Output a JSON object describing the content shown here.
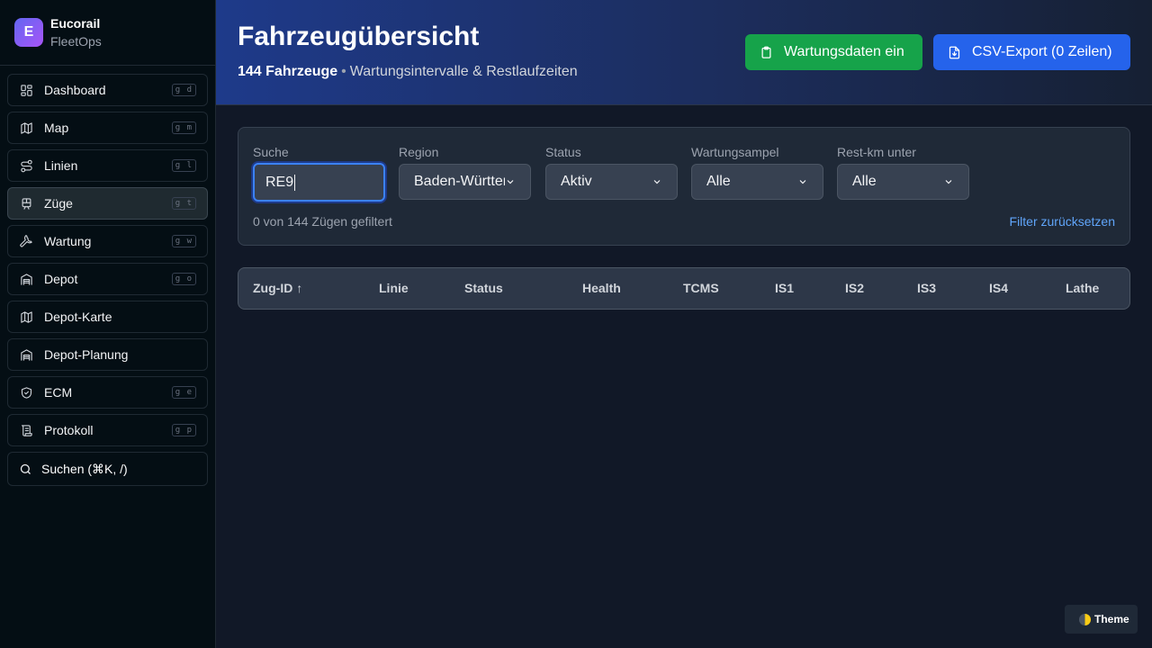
{
  "brand": {
    "logo_letter": "E",
    "name": "Eucorail",
    "sub": "FleetOps"
  },
  "sidebar": {
    "items": [
      {
        "label": "Dashboard",
        "shortcut": "g d",
        "icon": "dashboard-icon"
      },
      {
        "label": "Map",
        "shortcut": "g m",
        "icon": "map-icon"
      },
      {
        "label": "Linien",
        "shortcut": "g l",
        "icon": "route-icon"
      },
      {
        "label": "Züge",
        "shortcut": "g t",
        "icon": "train-icon",
        "active": true
      },
      {
        "label": "Wartung",
        "shortcut": "g w",
        "icon": "wrench-icon"
      },
      {
        "label": "Depot",
        "shortcut": "g o",
        "icon": "warehouse-icon"
      },
      {
        "label": "Depot-Karte",
        "shortcut": "",
        "icon": "map-icon"
      },
      {
        "label": "Depot-Planung",
        "shortcut": "",
        "icon": "warehouse-icon"
      },
      {
        "label": "ECM",
        "shortcut": "g e",
        "icon": "shield-icon"
      },
      {
        "label": "Protokoll",
        "shortcut": "g p",
        "icon": "scroll-icon"
      }
    ],
    "search_label": "Suchen (⌘K, /)"
  },
  "header": {
    "title": "Fahrzeugübersicht",
    "count": "144 Fahrzeuge",
    "separator": "•",
    "subtitle": "Wartungsintervalle & Restlaufzeiten",
    "btn_maintenance": "Wartungsdaten ein",
    "btn_export": "CSV-Export (0 Zeilen)"
  },
  "filters": {
    "search": {
      "label": "Suche",
      "value": "RE9"
    },
    "region": {
      "label": "Region",
      "value": "Baden-Württemberg"
    },
    "status": {
      "label": "Status",
      "value": "Aktiv"
    },
    "ampel": {
      "label": "Wartungsampel",
      "value": "Alle"
    },
    "restkm": {
      "label": "Rest-km unter",
      "value": "Alle"
    },
    "count_text": "0 von 144 Zügen gefiltert",
    "reset_label": "Filter zurücksetzen"
  },
  "table": {
    "columns": [
      "Zug-ID ↑",
      "Linie",
      "Status",
      "Health",
      "TCMS",
      "IS1",
      "IS2",
      "IS3",
      "IS4",
      "Lathe"
    ],
    "rows": []
  },
  "theme_label": "Theme",
  "colors": {
    "accent": "#2563eb",
    "success": "#16a34a",
    "link": "#60a5fa"
  }
}
